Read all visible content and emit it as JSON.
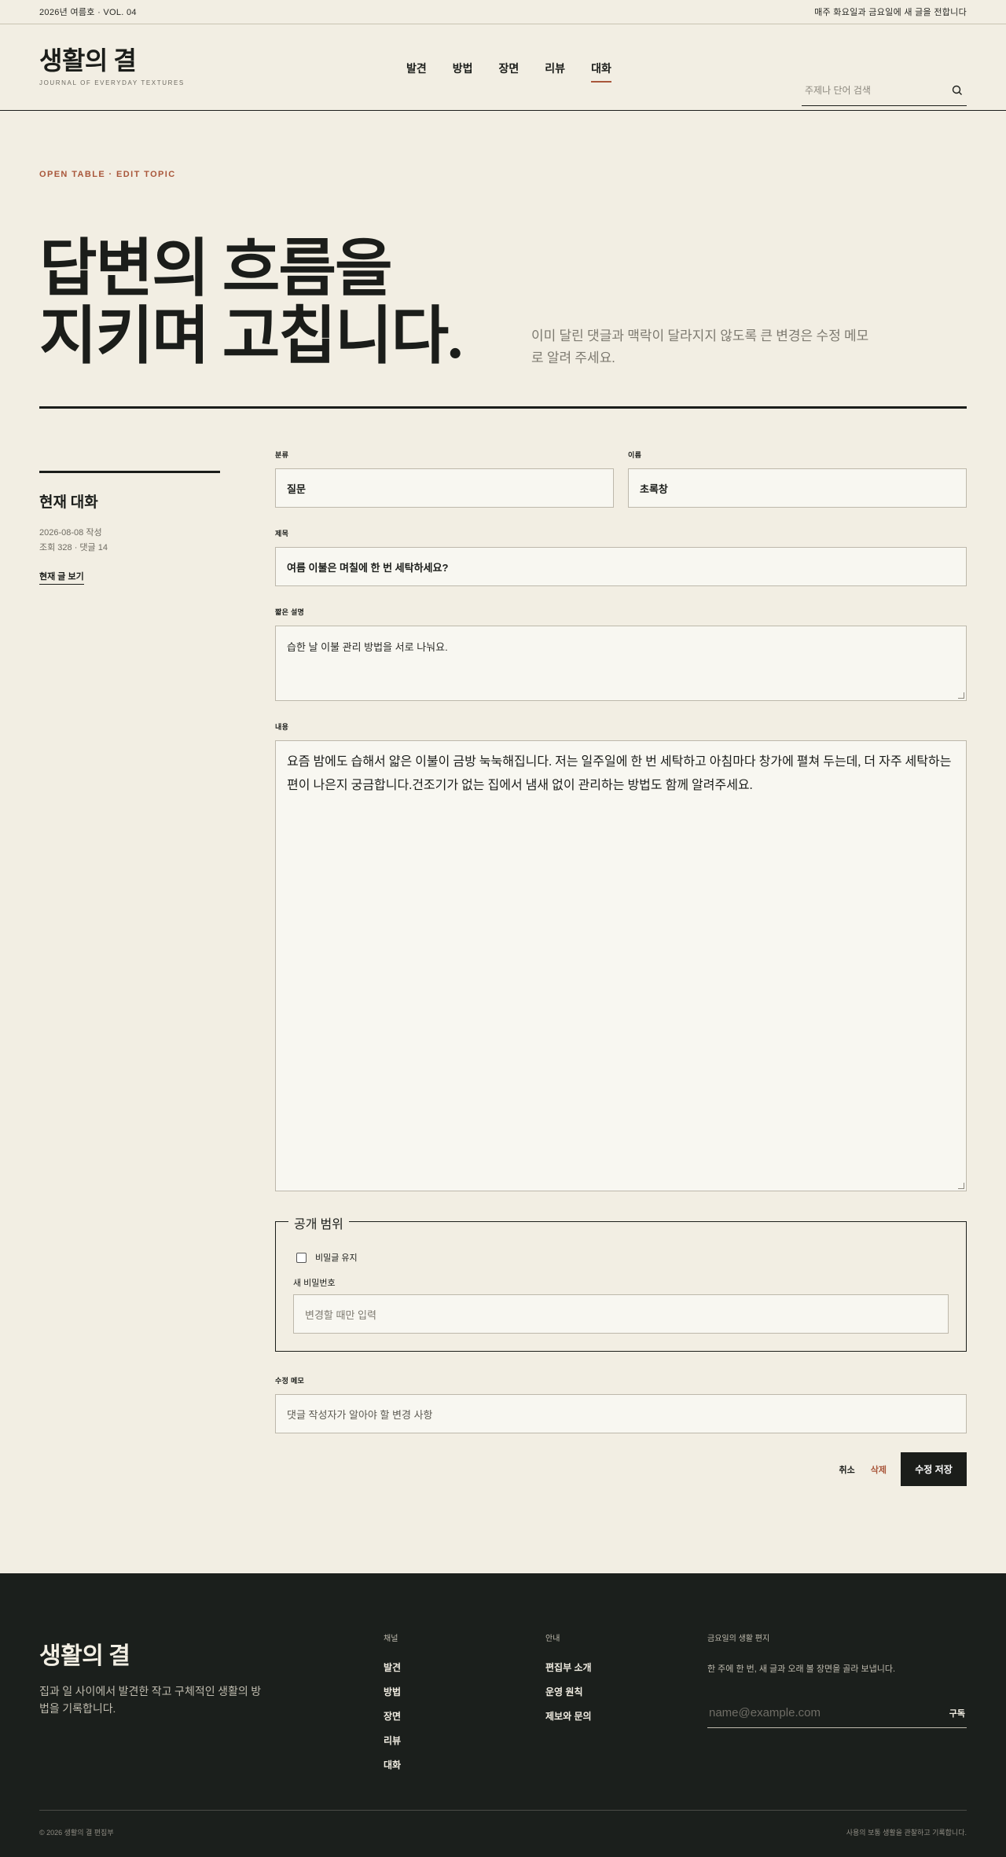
{
  "topbar": {
    "issue": "2026년 여름호 · VOL. 04",
    "notice": "매주 화요일과 금요일에 새 글을 전합니다"
  },
  "brand": {
    "name": "생활의 결",
    "tagline": "JOURNAL OF EVERYDAY TEXTURES"
  },
  "nav": [
    "발견",
    "방법",
    "장면",
    "리뷰",
    "대화"
  ],
  "search": {
    "placeholder": "주제나 단어 검색",
    "icon": "search-icon"
  },
  "hero": {
    "eyebrow": "OPEN TABLE · EDIT TOPIC",
    "title_line1": "답변의 흐름을",
    "title_line2": "지키며 고칩니다.",
    "description": "이미 달린 댓글과 맥락이 달라지지 않도록 큰 변경은 수정 메모로 알려 주세요."
  },
  "sidebar": {
    "heading": "현재 대화",
    "date": "2026-08-08 작성",
    "stats": "조회 328 · 댓글 14",
    "link": "현재 글 보기"
  },
  "form": {
    "category_label": "분류",
    "category_value": "질문",
    "name_label": "이름",
    "name_value": "초록창",
    "title_label": "제목",
    "title_value": "여름 이불은 며칠에 한 번 세탁하세요?",
    "summary_label": "짧은 설명",
    "summary_value": "습한 날 이불 관리 방법을 서로 나눠요.",
    "content_label": "내용",
    "content_value": "요즘 밤에도 습해서 얇은 이불이 금방 눅눅해집니다. 저는 일주일에 한 번 세탁하고 아침마다 창가에 펼쳐 두는데, 더 자주 세탁하는 편이 나은지 궁금합니다.건조기가 없는 집에서 냄새 없이 관리하는 방법도 함께 알려주세요.",
    "visibility_legend": "공개 범위",
    "secret_label": "비밀글 유지",
    "secret_checked": false,
    "password_label": "새 비밀번호",
    "password_placeholder": "변경할 때만 입력",
    "memo_label": "수정 메모",
    "memo_placeholder": "댓글 작성자가 알아야 할 변경 사항"
  },
  "actions": {
    "cancel": "취소",
    "delete": "삭제",
    "save": "수정 저장"
  },
  "footer": {
    "logo": "생활의 결",
    "desc": "집과 일 사이에서 발견한 작고 구체적인 생활의 방법을 기록합니다.",
    "col1_title": "채널",
    "col1_links": [
      "발견",
      "방법",
      "장면",
      "리뷰",
      "대화"
    ],
    "col2_title": "안내",
    "col2_links": [
      "편집부 소개",
      "운영 원칙",
      "제보와 문의"
    ],
    "news_title": "금요일의 생활 편지",
    "news_desc": "한 주에 한 번, 새 글과 오래 볼 장면을 골라 보냅니다.",
    "email_placeholder": "name@example.com",
    "subscribe": "구독",
    "copyright": "© 2026 생활의 결 편집부",
    "right_note": "사용의 보통 생활을 관찰하고 기록합니다."
  }
}
